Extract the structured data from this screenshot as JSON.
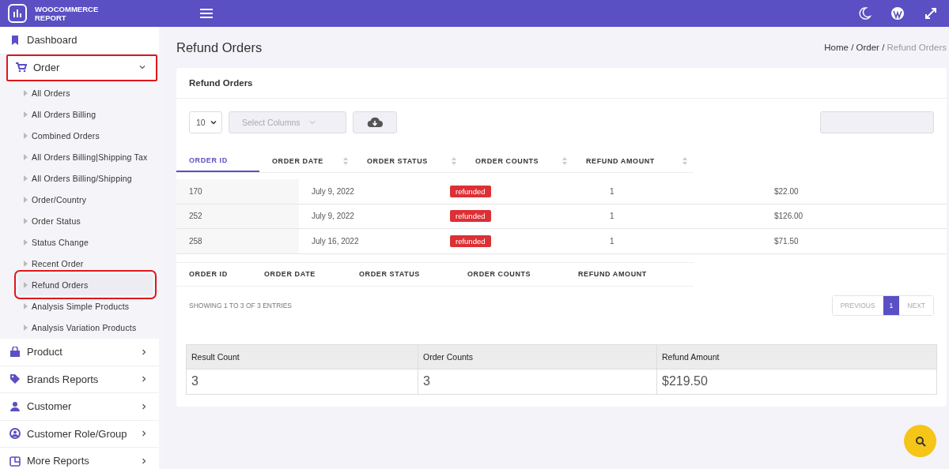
{
  "brand": {
    "lines": [
      "WOOCOMMERCE",
      "REPORT"
    ]
  },
  "sidebar": {
    "items": [
      {
        "label": "Dashboard",
        "marked": false
      },
      {
        "label": "Order",
        "expanded": true,
        "marked": true,
        "children": [
          {
            "label": "All Orders",
            "selected": false,
            "marked": false
          },
          {
            "label": "All Orders Billing",
            "selected": false,
            "marked": false
          },
          {
            "label": "Combined Orders",
            "selected": false,
            "marked": false
          },
          {
            "label": "All Orders Billing|Shipping Tax",
            "selected": false,
            "marked": false
          },
          {
            "label": "All Orders Billing/Shipping",
            "selected": false,
            "marked": false
          },
          {
            "label": "Order/Country",
            "selected": false,
            "marked": false
          },
          {
            "label": "Order Status",
            "selected": false,
            "marked": false
          },
          {
            "label": "Status Change",
            "selected": false,
            "marked": false
          },
          {
            "label": "Recent Order",
            "selected": false,
            "marked": false
          },
          {
            "label": "Refund Orders",
            "selected": true,
            "marked": true
          },
          {
            "label": "Analysis Simple Products",
            "selected": false,
            "marked": false
          },
          {
            "label": "Analysis Variation Products",
            "selected": false,
            "marked": false
          }
        ]
      },
      {
        "label": "Product",
        "expanded": false,
        "marked": false
      },
      {
        "label": "Brands Reports",
        "expanded": false,
        "marked": false
      },
      {
        "label": "Customer",
        "expanded": false,
        "marked": false
      },
      {
        "label": "Customer Role/Group",
        "expanded": false,
        "marked": false
      },
      {
        "label": "More Reports",
        "expanded": false,
        "marked": false
      }
    ]
  },
  "page": {
    "title": "Refund Orders",
    "breadcrumb_separator": "/",
    "breadcrumb": [
      {
        "label": "Home",
        "current": false
      },
      {
        "label": "Order",
        "current": false
      },
      {
        "label": "Refund Orders",
        "current": true
      }
    ]
  },
  "card": {
    "title": "Refund Orders",
    "page_length": "10",
    "select_columns": {
      "placeholder": "Select Columns"
    },
    "table": {
      "columns": [
        {
          "label": "ORDER ID",
          "sorted": true
        },
        {
          "label": "ORDER DATE",
          "sorted": false
        },
        {
          "label": "ORDER STATUS",
          "sorted": false
        },
        {
          "label": "ORDER COUNTS",
          "sorted": false
        },
        {
          "label": "REFUND AMOUNT",
          "sorted": false
        }
      ],
      "rows": [
        {
          "order_id": "170",
          "order_date": "July 9, 2022",
          "order_status": "refunded",
          "order_counts": "1",
          "refund_amount": "$22.00"
        },
        {
          "order_id": "252",
          "order_date": "July 9, 2022",
          "order_status": "refunded",
          "order_counts": "1",
          "refund_amount": "$126.00"
        },
        {
          "order_id": "258",
          "order_date": "July 16, 2022",
          "order_status": "refunded",
          "order_counts": "1",
          "refund_amount": "$71.50"
        }
      ],
      "footer_columns": [
        "ORDER ID",
        "ORDER DATE",
        "ORDER STATUS",
        "ORDER COUNTS",
        "REFUND AMOUNT"
      ]
    },
    "info": "SHOWING 1 TO 3 OF 3 ENTRIES",
    "pagination": [
      {
        "label": "PREVIOUS",
        "selected": false,
        "disabled": true
      },
      {
        "label": "1",
        "selected": true,
        "disabled": false
      },
      {
        "label": "NEXT",
        "selected": false,
        "disabled": true
      }
    ],
    "summary": {
      "columns": [
        "Result Count",
        "Order Counts",
        "Refund Amount"
      ],
      "values": [
        "3",
        "3",
        "$219.50"
      ]
    }
  }
}
